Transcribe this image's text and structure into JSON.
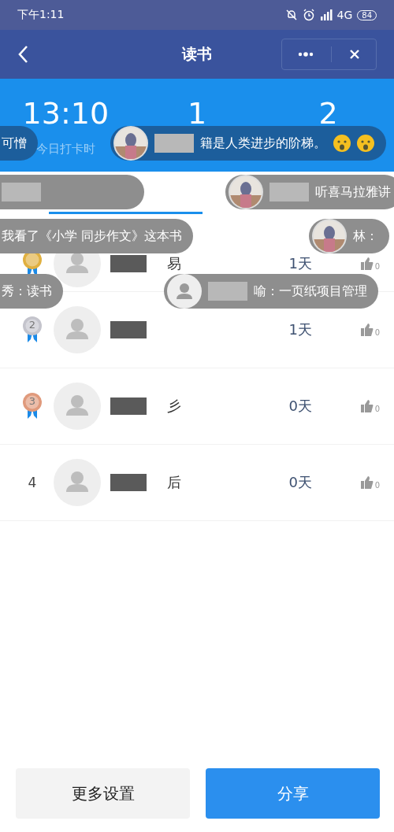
{
  "status_bar": {
    "time": "下午1:11",
    "network": "4G",
    "battery": "84"
  },
  "nav": {
    "title": "读书"
  },
  "stats": [
    {
      "value": "13:10",
      "label": "今日打卡时"
    },
    {
      "value": "1"
    },
    {
      "value": "2"
    }
  ],
  "rows": [
    {
      "kind": "medal",
      "color": "#e0b040",
      "name": "易",
      "days": "1天",
      "likes": "0"
    },
    {
      "kind": "medal",
      "color": "#c4c4cc",
      "rank": "2",
      "days": "1天",
      "likes": "0"
    },
    {
      "kind": "medal",
      "color": "#e09a7c",
      "rank": "3",
      "name": "彡",
      "days": "0天",
      "likes": "0"
    },
    {
      "kind": "plain",
      "rank": "4",
      "name": "后",
      "days": "0天",
      "likes": "0"
    }
  ],
  "bubbles": [
    {
      "kind": "plain",
      "color": "#1c5e9c",
      "text": "可憎"
    },
    {
      "kind": "picture",
      "color": "#1c5e9c",
      "text": "籍是人类进步的阶梯。",
      "emoji": true
    },
    {
      "kind": "plain",
      "color": "#8e8e8e"
    },
    {
      "kind": "picture",
      "color": "#8e8e8e",
      "text": "听喜马拉雅讲"
    },
    {
      "kind": "plain",
      "color": "#8e8e8e",
      "text": "我看了《小学  同步作文》这本书"
    },
    {
      "kind": "picture",
      "color": "#8e8e8e",
      "text": "林："
    },
    {
      "kind": "plain",
      "color": "#8e8e8e",
      "text": "秀：读书"
    },
    {
      "kind": "default",
      "color": "#8e8e8e",
      "text": "喻：一页纸项目管理"
    }
  ],
  "buttons": [
    {
      "label": "更多设置",
      "kind": "secondary"
    },
    {
      "label": "分享",
      "kind": "primary"
    }
  ]
}
